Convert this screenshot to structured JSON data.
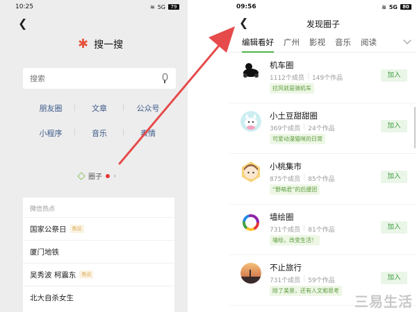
{
  "left": {
    "status": {
      "time": "10:25",
      "battery": "79",
      "signal": "5G"
    },
    "title": "搜一搜",
    "search": {
      "placeholder": "搜索"
    },
    "categories": [
      "朋友圈",
      "文章",
      "公众号",
      "小程序",
      "音乐",
      "表情"
    ],
    "circle_link": "圈子",
    "hot": {
      "header": "微信热点",
      "items": [
        {
          "text": "国家公祭日",
          "tag": "热议"
        },
        {
          "text": "厦门地铁",
          "tag": ""
        },
        {
          "text": "吴秀波 柯震东",
          "tag": "热议"
        },
        {
          "text": "北大自杀女生",
          "tag": ""
        }
      ]
    }
  },
  "right": {
    "status": {
      "time": "09:56",
      "battery": "80",
      "signal": "5G"
    },
    "title": "发现圈子",
    "tabs": [
      "编辑看好",
      "广州",
      "影视",
      "音乐",
      "阅读"
    ],
    "join_label": "加入",
    "items": [
      {
        "name": "机车圈",
        "members": "1112个成员",
        "works": "149个作品",
        "tag": "拉风就是骑机车"
      },
      {
        "name": "小土豆甜甜圈",
        "members": "369个成员",
        "works": "24个作品",
        "tag": "可爱动漫猫咪的日常"
      },
      {
        "name": "小桃集市",
        "members": "875个成员",
        "works": "85个作品",
        "tag": "“野萌君”的后援团"
      },
      {
        "name": "墙绘圈",
        "members": "731个成员",
        "works": "81个作品",
        "tag": "墙绘，改变生活！"
      },
      {
        "name": "不止旅行",
        "members": "731个成员",
        "works": "59个作品",
        "tag": "除了美景，还有人文和思考"
      }
    ]
  },
  "watermark": "三易生活",
  "colors": {
    "accent_green": "#4bb34b",
    "arrow": "#e64a4a",
    "hot_tag": "#d9a44a"
  }
}
